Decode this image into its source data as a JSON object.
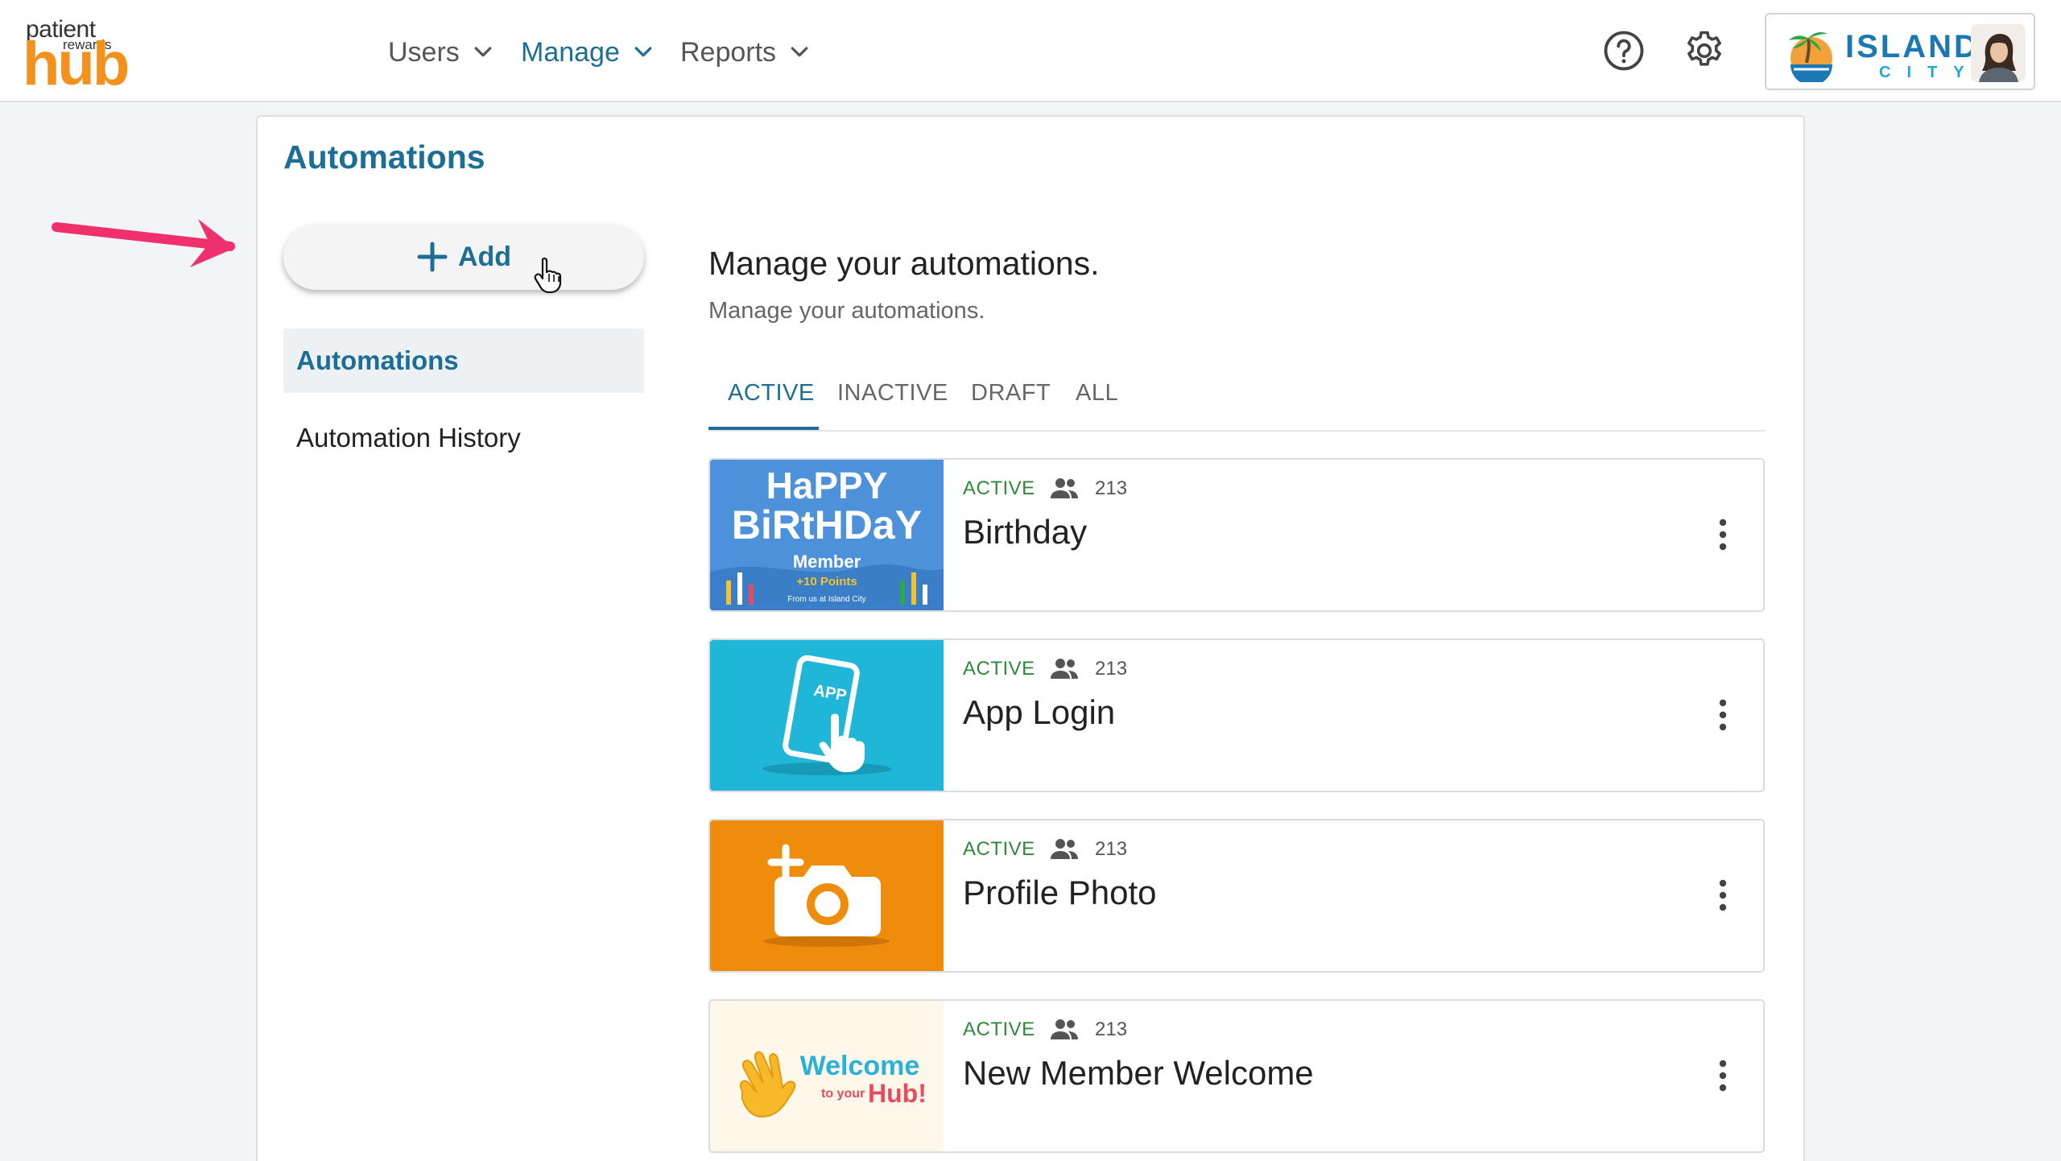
{
  "logo": {
    "line1": "patient",
    "line2": "rewards",
    "line3": "hub"
  },
  "nav": [
    {
      "label": "Users"
    },
    {
      "label": "Manage"
    },
    {
      "label": "Reports"
    }
  ],
  "header_icons": {
    "help": "help-circle-icon",
    "settings": "gear-icon"
  },
  "brand": {
    "name_line1": "ISLAND",
    "name_line2": "CITY"
  },
  "page_title": "Automations",
  "add_button": {
    "label": "Add"
  },
  "sidebar": {
    "items": [
      {
        "label": "Automations"
      },
      {
        "label": "Automation History"
      }
    ]
  },
  "main": {
    "heading": "Manage your automations.",
    "subheading": "Manage your automations."
  },
  "tabs": [
    {
      "label": "ACTIVE"
    },
    {
      "label": "INACTIVE"
    },
    {
      "label": "DRAFT"
    },
    {
      "label": "ALL"
    }
  ],
  "automations": [
    {
      "status": "ACTIVE",
      "count": "213",
      "name": "Birthday",
      "thumb": {
        "line1": "HaPPY",
        "line2": "BiRtHDaY",
        "line3": "Member",
        "line4": "+10 Points",
        "line5": "From us at Island City"
      }
    },
    {
      "status": "ACTIVE",
      "count": "213",
      "name": "App Login",
      "thumb": {
        "text": "APP"
      }
    },
    {
      "status": "ACTIVE",
      "count": "213",
      "name": "Profile Photo"
    },
    {
      "status": "ACTIVE",
      "count": "213",
      "name": "New Member Welcome",
      "thumb": {
        "line1": "Welcome",
        "line2": "to your",
        "line3": "Hub!"
      }
    }
  ],
  "colors": {
    "accent": "#1d6e94",
    "status_active": "#2e8a3a",
    "brand_orange": "#f2921d",
    "annotation_arrow": "#f0306e"
  }
}
